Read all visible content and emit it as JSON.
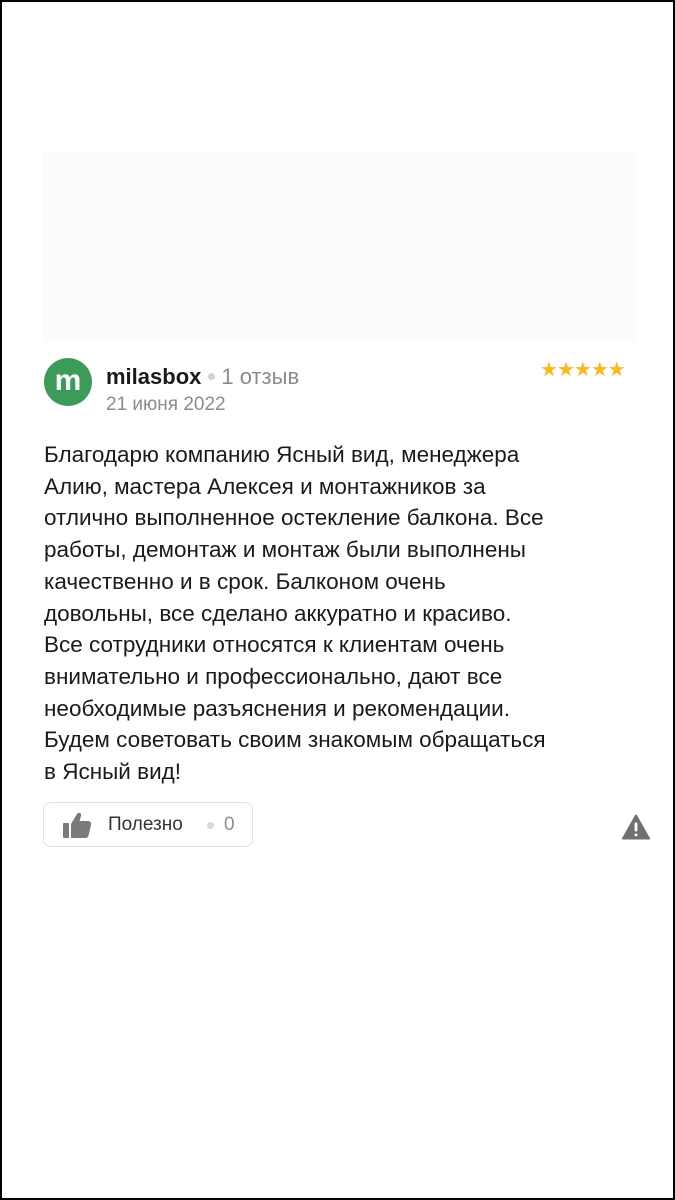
{
  "review": {
    "author": {
      "avatar_letter": "m",
      "avatar_color": "#3d9b59",
      "name": "milasbox",
      "review_count": "1 отзыв"
    },
    "date": "21 июня 2022",
    "rating": 5,
    "rating_max": 5,
    "star_color": "#f9b81c",
    "text": "Благодарю компанию Ясный вид, менеджера Алию, мастера Алексея и монтажников за отлично выполненное остекление балкона. Все работы, демонтаж и монтаж были выполнены качественно и в срок. Балконом очень довольны, все сделано аккуратно и красиво. Все сотрудники относятся к клиентам очень внимательно и профессионально, дают все необходимые разъяснения и рекомендации. Будем советовать своим знакомым обращаться в Ясный вид!",
    "text_lines": [
      "Благодарю компанию Ясный вид, менеджера",
      "Алию, мастера Алексея и монтажников за",
      "отлично выполненное остекление балкона. Все",
      "работы, демонтаж и монтаж были выполнены",
      "качественно и в срок. Балконом очень",
      "довольны, все сделано аккуратно и красиво.",
      "Все сотрудники относятся к клиентам очень",
      "внимательно и профессионально, дают все",
      "необходимые разъяснения и рекомендации.",
      "Будем советовать своим знакомым обращаться",
      "в Ясный вид!"
    ],
    "helpful": {
      "icon": "thumbs-up-icon",
      "label": "Полезно",
      "count": "0"
    },
    "report": {
      "icon": "warning-icon"
    }
  }
}
